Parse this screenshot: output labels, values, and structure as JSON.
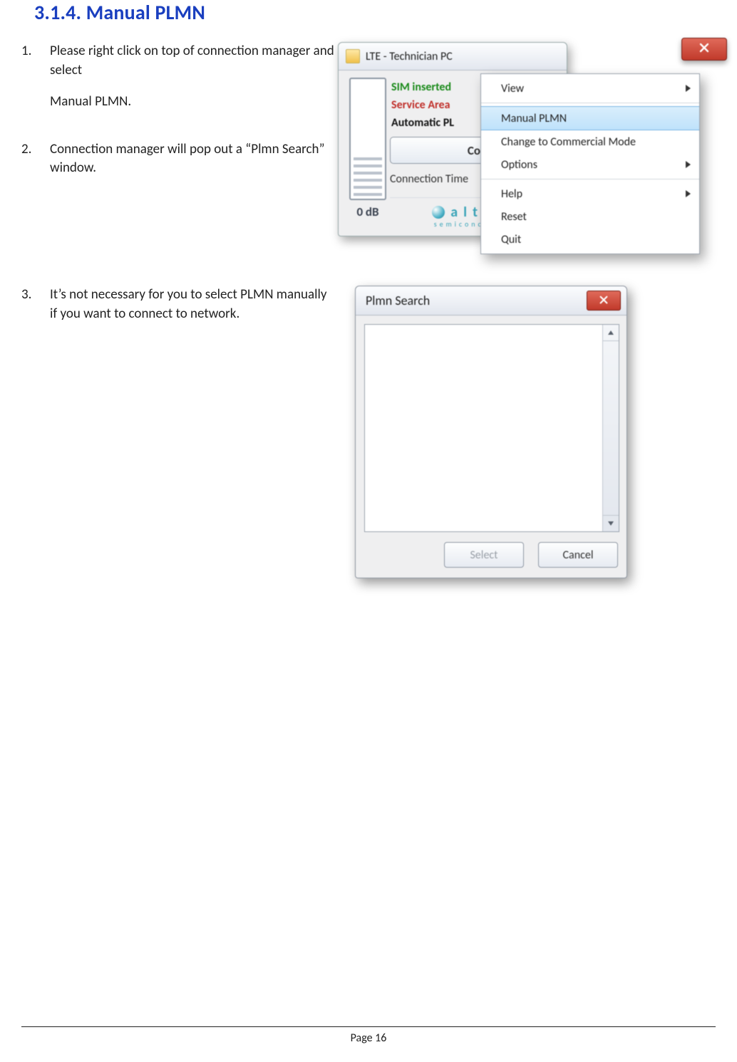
{
  "section": {
    "title": "3.1.4. Manual PLMN"
  },
  "steps": [
    {
      "num": "1.",
      "lines": [
        "Please right click on top of connection manager and select",
        "Manual PLMN."
      ]
    },
    {
      "num": "2.",
      "lines": [
        "Connection manager will pop out a “Plmn Search” window."
      ]
    },
    {
      "num": "3.",
      "lines": [
        "It’s not necessary for you to select PLMN manually if you want to connect to network."
      ]
    }
  ],
  "lte_window": {
    "title": "LTE - Technician PC",
    "signal_db": "0 dB",
    "status": {
      "sim": "SIM inserted",
      "service": "Service Area",
      "plmn": "Automatic PL"
    },
    "connect_label": "Co",
    "conn_time_label": "Connection Time",
    "brand": "altair",
    "brand_sub": "semiconductor"
  },
  "context_menu": {
    "items": [
      {
        "label": "View",
        "arrow": true,
        "hl": false
      },
      {
        "label": "Manual PLMN",
        "arrow": false,
        "hl": true
      },
      {
        "label": "Change to Commercial Mode",
        "arrow": false,
        "hl": false
      },
      {
        "label": "Options",
        "arrow": true,
        "hl": false
      },
      {
        "label": "Help",
        "arrow": true,
        "hl": false
      },
      {
        "label": "Reset",
        "arrow": false,
        "hl": false
      },
      {
        "label": "Quit",
        "arrow": false,
        "hl": false
      }
    ]
  },
  "plmn_dialog": {
    "title": "Plmn Search",
    "select_label": "Select",
    "cancel_label": "Cancel"
  },
  "footer": {
    "page": "Page 16"
  }
}
